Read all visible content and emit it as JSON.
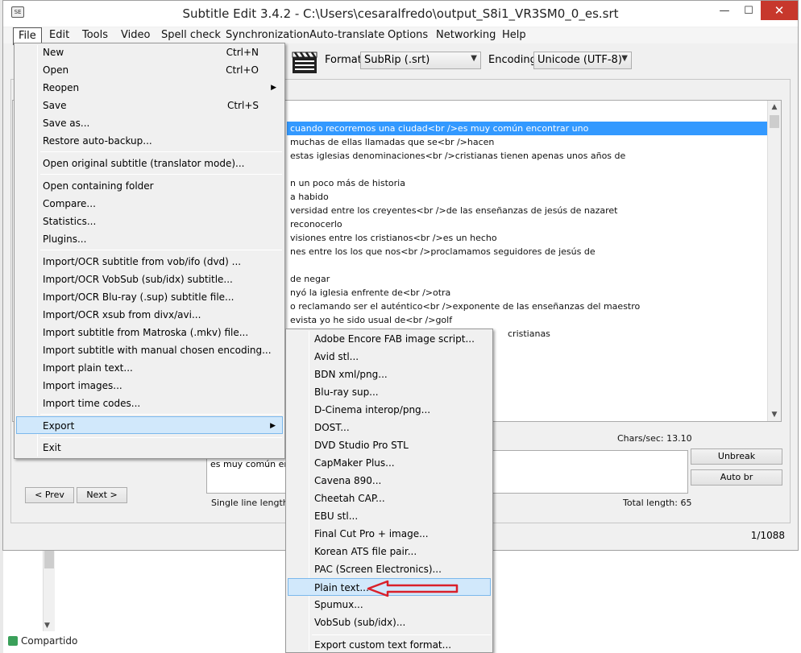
{
  "window": {
    "title": "Subtitle Edit 3.4.2 - C:\\Users\\cesaralfredo\\output_S8i1_VR3SM0_0_es.srt",
    "app_icon": "SE",
    "minimize": "—",
    "maximize": "☐",
    "close": "✕"
  },
  "menubar": [
    "File",
    "Edit",
    "Tools",
    "Video",
    "Spell check",
    "Synchronization",
    "Auto-translate",
    "Options",
    "Networking",
    "Help"
  ],
  "toolbar": {
    "format_label": "Format",
    "format_value": "SubRip (.srt)",
    "encoding_label": "Encoding",
    "encoding_value": "Unicode (UTF-8)"
  },
  "subtitle_rows": [
    "cuando recorremos una ciudad<br />es muy común encontrar uno",
    "muchas de ellas llamadas que se<br />hacen",
    "estas iglesias denominaciones<br />cristianas tienen apenas unos años de",
    "",
    "n un poco más de historia",
    "a habido",
    "versidad entre los creyentes<br />de las enseñanzas de jesús de nazaret",
    "reconocerlo",
    "visiones entre los cristianos<br />es un hecho",
    "nes entre los los que nos<br />proclamamos seguidores de jesús de",
    "",
    "de negar",
    "nyó la iglesia enfrente de<br />otra",
    "o reclamando ser el auténtico<br />exponente de las enseñanzas del maestro",
    "evista yo he sido usual de<br />golf",
    "cristianas"
  ],
  "editor": {
    "chars_sec": "Chars/sec: 13.10",
    "text": "es muy común enco",
    "single_line_length": "Single line length: 3",
    "total_length": "Total length: 65",
    "unbreak": "Unbreak",
    "auto_br": "Auto br",
    "prev": "< Prev",
    "next": "Next >"
  },
  "status": {
    "count": "1/1088"
  },
  "taskbar": {
    "label": "Compartido"
  },
  "file_menu": [
    {
      "label": "New",
      "shortcut": "Ctrl+N"
    },
    {
      "label": "Open",
      "shortcut": "Ctrl+O"
    },
    {
      "label": "Reopen",
      "submenu": true
    },
    {
      "label": "Save",
      "shortcut": "Ctrl+S"
    },
    {
      "label": "Save as..."
    },
    {
      "label": "Restore auto-backup..."
    },
    {
      "label": "Open original subtitle (translator mode)..."
    },
    {
      "label": "Open containing folder"
    },
    {
      "label": "Compare..."
    },
    {
      "label": "Statistics..."
    },
    {
      "label": "Plugins..."
    },
    {
      "label": "Import/OCR subtitle from vob/ifo (dvd) ..."
    },
    {
      "label": "Import/OCR VobSub (sub/idx) subtitle..."
    },
    {
      "label": "Import/OCR Blu-ray (.sup) subtitle file..."
    },
    {
      "label": "Import/OCR xsub from divx/avi..."
    },
    {
      "label": "Import subtitle from Matroska (.mkv) file..."
    },
    {
      "label": "Import subtitle with manual chosen encoding..."
    },
    {
      "label": "Import plain text..."
    },
    {
      "label": "Import images..."
    },
    {
      "label": "Import time codes..."
    },
    {
      "label": "Export",
      "submenu": true,
      "highlighted": true
    },
    {
      "label": "Exit"
    }
  ],
  "export_menu": [
    {
      "label": "Adobe Encore FAB image script..."
    },
    {
      "label": "Avid stl..."
    },
    {
      "label": "BDN xml/png..."
    },
    {
      "label": "Blu-ray sup..."
    },
    {
      "label": "D-Cinema interop/png..."
    },
    {
      "label": "DOST..."
    },
    {
      "label": "DVD Studio Pro STL"
    },
    {
      "label": "CapMaker Plus..."
    },
    {
      "label": "Cavena 890..."
    },
    {
      "label": "Cheetah CAP..."
    },
    {
      "label": "EBU stl..."
    },
    {
      "label": "Final Cut Pro + image..."
    },
    {
      "label": "Korean ATS file pair..."
    },
    {
      "label": "PAC (Screen Electronics)..."
    },
    {
      "label": "Plain text...",
      "highlighted": true
    },
    {
      "label": "Spumux..."
    },
    {
      "label": "VobSub (sub/idx)..."
    },
    {
      "label": "Export custom text format..."
    }
  ],
  "icons": {
    "submenu_arrow": "▶",
    "combo_arrow": "▼",
    "scroll_up": "▲",
    "scroll_down": "▼"
  },
  "colors": {
    "selection": "#3399ff",
    "menu_highlight": "#d1e8fb",
    "close_button": "#c7382c",
    "annotation_arrow": "#d9202a"
  }
}
